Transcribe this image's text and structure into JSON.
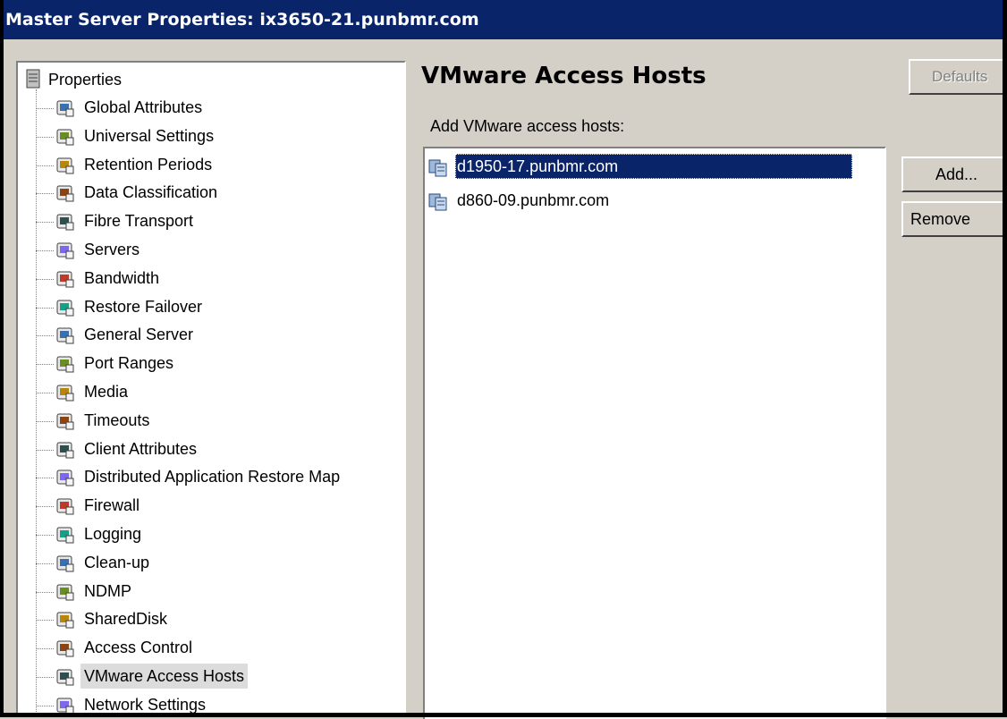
{
  "window": {
    "title": "Master Server Properties: ix3650-21.punbmr.com"
  },
  "tree": {
    "root_label": "Properties",
    "items": [
      {
        "label": "Global Attributes",
        "icon": "globe-calendar-icon"
      },
      {
        "label": "Universal Settings",
        "icon": "globe-settings-icon"
      },
      {
        "label": "Retention Periods",
        "icon": "retention-icon"
      },
      {
        "label": "Data Classification",
        "icon": "data-classification-icon"
      },
      {
        "label": "Fibre Transport",
        "icon": "monitor-icon"
      },
      {
        "label": "Servers",
        "icon": "server-icon"
      },
      {
        "label": "Bandwidth",
        "icon": "bandwidth-icon"
      },
      {
        "label": "Restore Failover",
        "icon": "restore-failover-icon"
      },
      {
        "label": "General Server",
        "icon": "server-icon"
      },
      {
        "label": "Port Ranges",
        "icon": "port-icon"
      },
      {
        "label": "Media",
        "icon": "media-icon"
      },
      {
        "label": "Timeouts",
        "icon": "clock-icon"
      },
      {
        "label": "Client Attributes",
        "icon": "client-attributes-icon"
      },
      {
        "label": "Distributed Application Restore Map",
        "icon": "database-icon"
      },
      {
        "label": "Firewall",
        "icon": "firewall-icon"
      },
      {
        "label": "Logging",
        "icon": "logging-icon"
      },
      {
        "label": "Clean-up",
        "icon": "cleanup-icon"
      },
      {
        "label": "NDMP",
        "icon": "ndmp-icon"
      },
      {
        "label": "SharedDisk",
        "icon": "shared-disk-icon"
      },
      {
        "label": "Access Control",
        "icon": "access-control-icon"
      },
      {
        "label": "VMware Access Hosts",
        "icon": "vmware-hosts-icon"
      },
      {
        "label": "Network Settings",
        "icon": "network-icon"
      }
    ],
    "selected_item": "VMware Access Hosts"
  },
  "panel": {
    "title": "VMware Access Hosts",
    "defaults_label": "Defaults",
    "hosts_label": "Add VMware access hosts:",
    "hosts": [
      {
        "name": "d1950-17.punbmr.com",
        "selected": true
      },
      {
        "name": "d860-09.punbmr.com",
        "selected": false
      }
    ],
    "add_label": "Add...",
    "remove_label": "Remove"
  },
  "colors": {
    "titlebar": "#0a246a",
    "selection": "#0a246a",
    "face": "#d4d0c8"
  }
}
